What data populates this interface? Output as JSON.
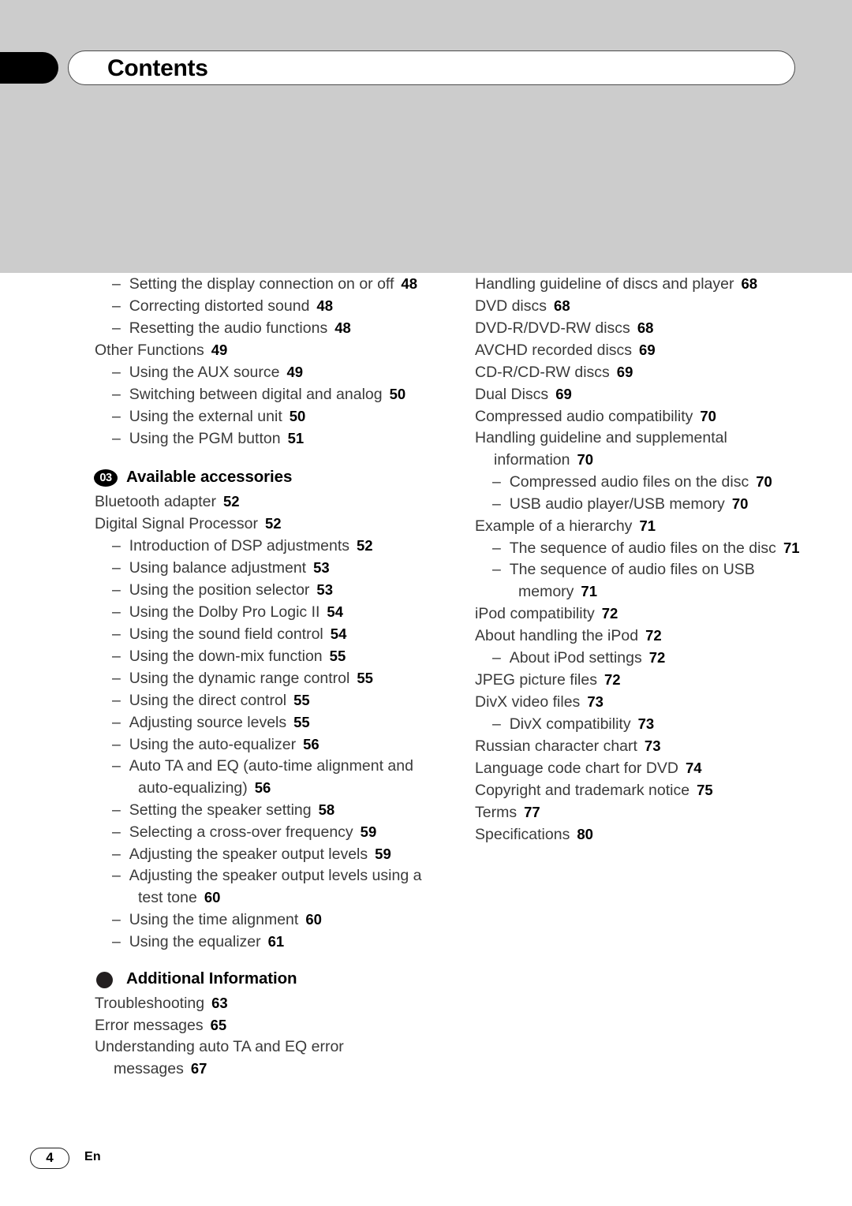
{
  "header": {
    "title": "Contents"
  },
  "footer": {
    "page_number": "4",
    "language_code": "En"
  },
  "columns": {
    "left": [
      {
        "type": "entry",
        "level": 1,
        "dash": "–",
        "label": "Setting the display connection on or off",
        "page": "48"
      },
      {
        "type": "entry",
        "level": 1,
        "dash": "–",
        "label": "Correcting distorted sound",
        "page": "48"
      },
      {
        "type": "entry",
        "level": 1,
        "dash": "–",
        "label": "Resetting the audio functions",
        "page": "48"
      },
      {
        "type": "entry",
        "level": 0,
        "label": "Other Functions",
        "page": "49"
      },
      {
        "type": "entry",
        "level": 1,
        "dash": "–",
        "label": "Using the AUX source",
        "page": "49"
      },
      {
        "type": "entry",
        "level": 1,
        "dash": "–",
        "label": "Switching between digital and analog",
        "page": "50"
      },
      {
        "type": "entry",
        "level": 1,
        "dash": "–",
        "label": "Using the external unit",
        "page": "50"
      },
      {
        "type": "entry",
        "level": 1,
        "dash": "–",
        "label": "Using the PGM button",
        "page": "51"
      },
      {
        "type": "heading",
        "badge": "03",
        "badge_kind": "number",
        "title": "Available accessories"
      },
      {
        "type": "entry",
        "level": 0,
        "label": "Bluetooth adapter",
        "page": "52"
      },
      {
        "type": "entry",
        "level": 0,
        "label": "Digital Signal Processor",
        "page": "52"
      },
      {
        "type": "entry",
        "level": 1,
        "dash": "–",
        "label": "Introduction of DSP adjustments",
        "page": "52"
      },
      {
        "type": "entry",
        "level": 1,
        "dash": "–",
        "label": "Using balance adjustment",
        "page": "53"
      },
      {
        "type": "entry",
        "level": 1,
        "dash": "–",
        "label": "Using the position selector",
        "page": "53"
      },
      {
        "type": "entry",
        "level": 1,
        "dash": "–",
        "label": "Using the Dolby Pro Logic II",
        "page": "54"
      },
      {
        "type": "entry",
        "level": 1,
        "dash": "–",
        "label": "Using the sound field control",
        "page": "54"
      },
      {
        "type": "entry",
        "level": 1,
        "dash": "–",
        "label": "Using the down-mix function",
        "page": "55"
      },
      {
        "type": "entry",
        "level": 1,
        "dash": "–",
        "label": "Using the dynamic range control",
        "page": "55"
      },
      {
        "type": "entry",
        "level": 1,
        "dash": "–",
        "label": "Using the direct control",
        "page": "55"
      },
      {
        "type": "entry",
        "level": 1,
        "dash": "–",
        "label": "Adjusting source levels",
        "page": "55"
      },
      {
        "type": "entry",
        "level": 1,
        "dash": "–",
        "label": "Using the auto-equalizer",
        "page": "56"
      },
      {
        "type": "entry",
        "level": 1,
        "dash": "–",
        "label": "Auto TA and EQ (auto-time alignment and auto-equalizing)",
        "page": "56"
      },
      {
        "type": "entry",
        "level": 1,
        "dash": "–",
        "label": "Setting the speaker setting",
        "page": "58"
      },
      {
        "type": "entry",
        "level": 1,
        "dash": "–",
        "label": "Selecting a cross-over frequency",
        "page": "59"
      },
      {
        "type": "entry",
        "level": 1,
        "dash": "–",
        "label": "Adjusting the speaker output levels",
        "page": "59"
      },
      {
        "type": "entry",
        "level": 1,
        "dash": "–",
        "label": "Adjusting the speaker output levels using a test tone",
        "page": "60"
      },
      {
        "type": "entry",
        "level": 1,
        "dash": "–",
        "label": "Using the time alignment",
        "page": "60"
      },
      {
        "type": "entry",
        "level": 1,
        "dash": "–",
        "label": "Using the equalizer",
        "page": "61"
      },
      {
        "type": "heading",
        "badge": "",
        "badge_kind": "dot",
        "title": "Additional Information"
      },
      {
        "type": "entry",
        "level": 0,
        "label": "Troubleshooting",
        "page": "63"
      },
      {
        "type": "entry",
        "level": 0,
        "label": "Error messages",
        "page": "65"
      },
      {
        "type": "entry",
        "level": 0,
        "label": "Understanding auto TA and EQ error messages",
        "page": "67"
      }
    ],
    "right": [
      {
        "type": "entry",
        "level": 0,
        "label": "Handling guideline of discs and player",
        "page": "68"
      },
      {
        "type": "entry",
        "level": 0,
        "label": "DVD discs",
        "page": "68"
      },
      {
        "type": "entry",
        "level": 0,
        "label": "DVD-R/DVD-RW discs",
        "page": "68"
      },
      {
        "type": "entry",
        "level": 0,
        "label": "AVCHD recorded discs",
        "page": "69"
      },
      {
        "type": "entry",
        "level": 0,
        "label": "CD-R/CD-RW discs",
        "page": "69"
      },
      {
        "type": "entry",
        "level": 0,
        "label": "Dual Discs",
        "page": "69"
      },
      {
        "type": "entry",
        "level": 0,
        "label": "Compressed audio compatibility",
        "page": "70"
      },
      {
        "type": "entry",
        "level": 0,
        "label": "Handling guideline and supplemental information",
        "page": "70"
      },
      {
        "type": "entry",
        "level": 1,
        "dash": "–",
        "label": "Compressed audio files on the disc",
        "page": "70"
      },
      {
        "type": "entry",
        "level": 1,
        "dash": "–",
        "label": "USB audio player/USB memory",
        "page": "70"
      },
      {
        "type": "entry",
        "level": 0,
        "label": "Example of a hierarchy",
        "page": "71"
      },
      {
        "type": "entry",
        "level": 1,
        "dash": "–",
        "label": "The sequence of audio files on the disc",
        "page": "71"
      },
      {
        "type": "entry",
        "level": 1,
        "dash": "–",
        "label": "The sequence of audio files on USB memory",
        "page": "71"
      },
      {
        "type": "entry",
        "level": 0,
        "label": "iPod compatibility",
        "page": "72"
      },
      {
        "type": "entry",
        "level": 0,
        "label": "About handling the iPod",
        "page": "72"
      },
      {
        "type": "entry",
        "level": 1,
        "dash": "–",
        "label": "About iPod settings",
        "page": "72"
      },
      {
        "type": "entry",
        "level": 0,
        "label": "JPEG picture files",
        "page": "72"
      },
      {
        "type": "entry",
        "level": 0,
        "label": "DivX video files",
        "page": "73"
      },
      {
        "type": "entry",
        "level": 1,
        "dash": "–",
        "label": "DivX compatibility",
        "page": "73"
      },
      {
        "type": "entry",
        "level": 0,
        "label": "Russian character chart",
        "page": "73"
      },
      {
        "type": "entry",
        "level": 0,
        "label": "Language code chart for DVD",
        "page": "74"
      },
      {
        "type": "entry",
        "level": 0,
        "label": "Copyright and trademark notice",
        "page": "75"
      },
      {
        "type": "entry",
        "level": 0,
        "label": "Terms",
        "page": "77"
      },
      {
        "type": "entry",
        "level": 0,
        "label": "Specifications",
        "page": "80"
      }
    ]
  }
}
